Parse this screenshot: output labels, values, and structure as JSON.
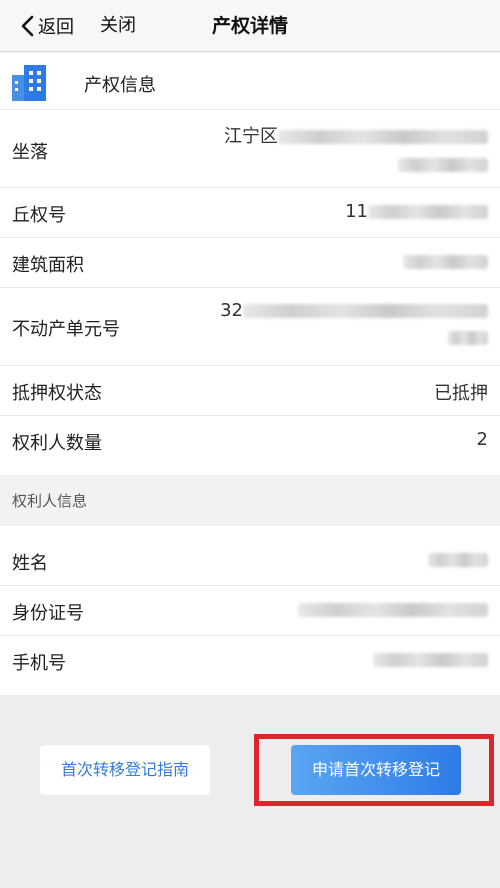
{
  "nav": {
    "back_label": "返回",
    "close_label": "关闭",
    "title": "产权详情"
  },
  "property_section": {
    "header_label": "产权信息",
    "rows": [
      {
        "label": "坐落",
        "value": "江宁区"
      },
      {
        "label": "丘权号",
        "value": "11"
      },
      {
        "label": "建筑面积",
        "value": ""
      },
      {
        "label": "不动产单元号",
        "value": "32"
      },
      {
        "label": "抵押权状态",
        "value": "已抵押"
      },
      {
        "label": "权利人数量",
        "value": "2"
      }
    ]
  },
  "holder_section": {
    "header_label": "权利人信息",
    "rows": [
      {
        "label": "姓名",
        "value": ""
      },
      {
        "label": "身份证号",
        "value": ""
      },
      {
        "label": "手机号",
        "value": ""
      }
    ]
  },
  "buttons": {
    "guide_label": "首次转移登记指南",
    "apply_label": "申请首次转移登记"
  },
  "colors": {
    "accent": "#3a7bd5",
    "apply_bg": "#2f7be6",
    "highlight": "#e0242c"
  }
}
